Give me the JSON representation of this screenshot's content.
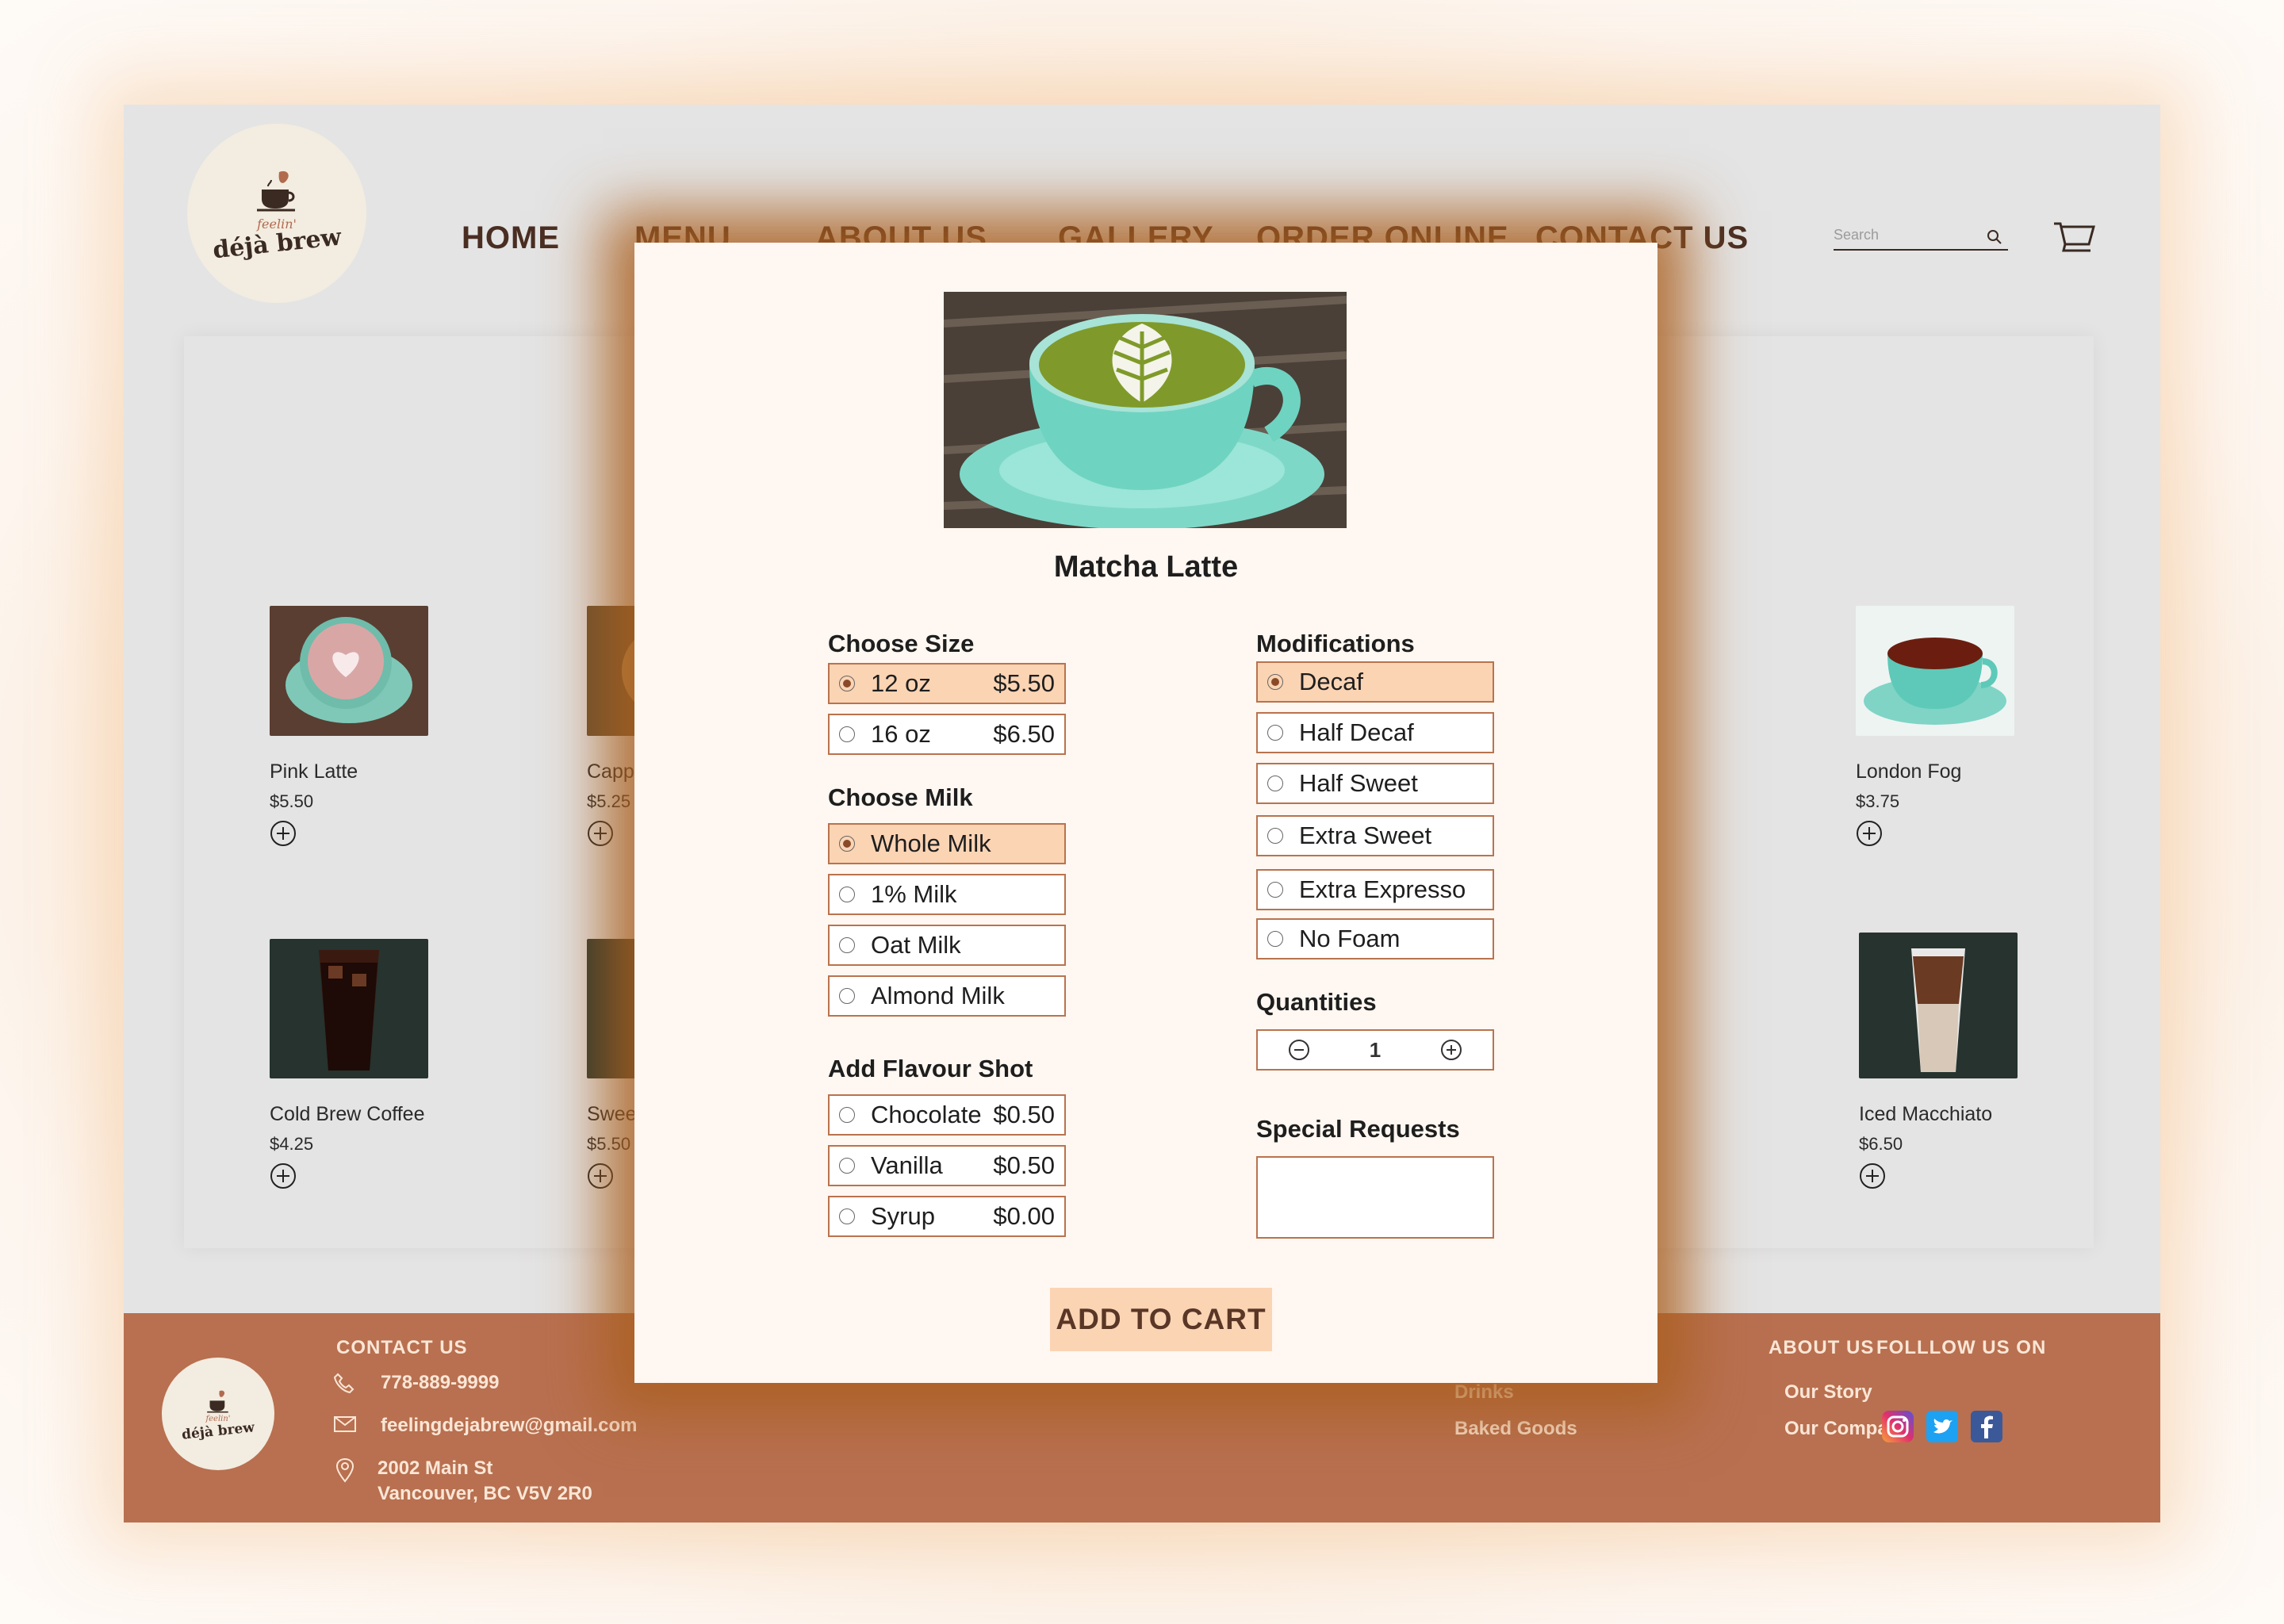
{
  "brand": {
    "tagline": "feelin'",
    "name": "déjà brew"
  },
  "nav": {
    "home": "HOME",
    "menu": "MENU",
    "about": "ABOUT US",
    "gallery": "GALLERY",
    "order": "ORDER ONLINE",
    "contact": "CONTACT US"
  },
  "search": {
    "placeholder": "Search"
  },
  "menu_items": [
    {
      "name": "Pink Latte",
      "price": "$5.50"
    },
    {
      "name": "Capp",
      "price": "$5.25"
    },
    {
      "name": "London Fog",
      "price": "$3.75"
    },
    {
      "name": "Cold Brew Coffee",
      "price": "$4.25"
    },
    {
      "name": "Swee",
      "price": "$5.50"
    },
    {
      "name": "Iced Macchiato",
      "price": "$6.50"
    }
  ],
  "modal": {
    "title": "Matcha Latte",
    "size": {
      "title": "Choose Size",
      "options": [
        {
          "label": "12 oz",
          "price": "$5.50",
          "selected": true
        },
        {
          "label": "16 oz",
          "price": "$6.50",
          "selected": false
        }
      ]
    },
    "milk": {
      "title": "Choose Milk",
      "options": [
        {
          "label": "Whole Milk",
          "selected": true
        },
        {
          "label": "1% Milk",
          "selected": false
        },
        {
          "label": "Oat Milk",
          "selected": false
        },
        {
          "label": "Almond Milk",
          "selected": false
        }
      ]
    },
    "flavour": {
      "title": "Add Flavour Shot",
      "options": [
        {
          "label": "Chocolate",
          "price": "$0.50",
          "selected": false
        },
        {
          "label": "Vanilla",
          "price": "$0.50",
          "selected": false
        },
        {
          "label": "Syrup",
          "price": "$0.00",
          "selected": false
        }
      ]
    },
    "mods": {
      "title": "Modifications",
      "options": [
        {
          "label": "Decaf",
          "selected": true
        },
        {
          "label": "Half Decaf",
          "selected": false
        },
        {
          "label": "Half Sweet",
          "selected": false
        },
        {
          "label": "Extra Sweet",
          "selected": false
        },
        {
          "label": "Extra Expresso",
          "selected": false
        },
        {
          "label": "No Foam",
          "selected": false
        }
      ]
    },
    "quantities": {
      "title": "Quantities",
      "value": "1"
    },
    "special": {
      "title": "Special Requests"
    },
    "add_to_cart": "ADD TO CART"
  },
  "footer": {
    "contact_title": "CONTACT US",
    "phone": "778-889-9999",
    "email": "feelingdejabrew@gmail.com",
    "address_line1": "2002 Main St",
    "address_line2": "Vancouver, BC V5V 2R0",
    "menu_links": [
      "Drinks",
      "Baked Goods"
    ],
    "about_title": "ABOUT US",
    "about_links": [
      "Our Story",
      "Our Company"
    ],
    "follow_title": "FOLLLOW US ON",
    "social": [
      "instagram-icon",
      "twitter-icon",
      "facebook-icon"
    ]
  },
  "colors": {
    "accent": "#b87050",
    "highlight": "#fbd4b4",
    "border": "#b9734e",
    "nav_text": "#4a2e22"
  }
}
